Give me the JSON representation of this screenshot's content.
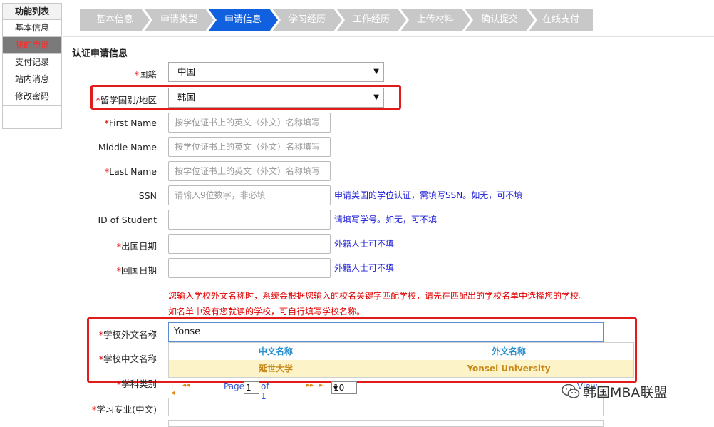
{
  "sidebar": {
    "title": "功能列表",
    "items": [
      {
        "label": "基本信息"
      },
      {
        "label": "我的申请"
      },
      {
        "label": "支付记录"
      },
      {
        "label": "站内消息"
      },
      {
        "label": "修改密码"
      }
    ]
  },
  "steps": [
    "基本信息",
    "申请类型",
    "申请信息",
    "学习经历",
    "工作经历",
    "上传材料",
    "确认提交",
    "在线支付"
  ],
  "section_title": "认证申请信息",
  "form": {
    "required_mark": "*",
    "nationality": {
      "label": "国籍",
      "value": "中国"
    },
    "study_country": {
      "label": "留学国别/地区",
      "value": "韩国"
    },
    "first_name": {
      "label": "First Name",
      "placeholder": "按学位证书上的英文（外文）名称填写"
    },
    "middle_name": {
      "label": "Middle Name",
      "placeholder": "按学位证书上的英文（外文）名称填写"
    },
    "last_name": {
      "label": "Last Name",
      "placeholder": "按学位证书上的英文（外文）名称填写"
    },
    "ssn": {
      "label": "SSN",
      "placeholder": "请输入9位数字，非必填",
      "hint": "申请美国的学位认证，需填写SSN。如无，可不填"
    },
    "student_id": {
      "label": "ID of Student",
      "hint": "请填写学号。如无，可不填"
    },
    "departure_date": {
      "label": "出国日期",
      "hint": "外籍人士可不填"
    },
    "return_date": {
      "label": "回国日期",
      "hint": "外籍人士可不填"
    },
    "school_notice_1": "您输入学校外文名称时，系统会根据您输入的校名关键字匹配学校，请先在匹配出的学校名单中选择您的学校。",
    "school_notice_2": "如名单中没有您就读的学校，可自行填写学校名称。",
    "school_foreign_name": {
      "label": "学校外文名称",
      "value": "Yonse"
    },
    "school_cn_name": {
      "label": "学校中文名称"
    },
    "subject_category": {
      "label": "学科类别"
    },
    "major_cn": {
      "label": "学习专业(中文)"
    }
  },
  "dropdown": {
    "col_cn": "中文名称",
    "col_foreign": "外文名称",
    "rows": [
      {
        "cn": "延世大学",
        "foreign": "Yonsei University"
      }
    ]
  },
  "pager": {
    "first": "|◂",
    "prev": "◂◂",
    "page_label": "Page",
    "page": "1",
    "of": "of 1",
    "next": "▸▸",
    "last": "▸|",
    "size": "10",
    "view": "View"
  },
  "watermark": "韩国MBA联盟",
  "colors": {
    "active_step": "#1060e0",
    "highlight": "#e21b1b"
  }
}
